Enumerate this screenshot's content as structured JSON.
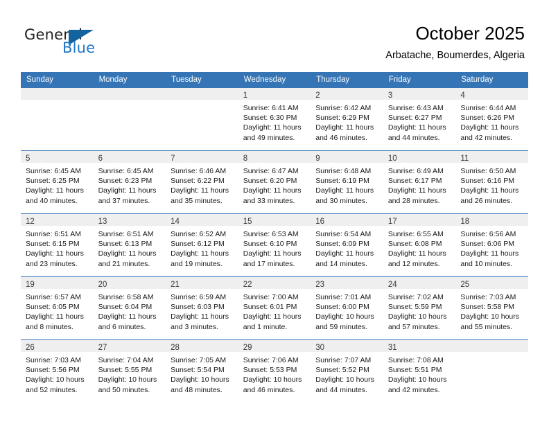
{
  "brand": {
    "name_part1": "General",
    "name_part2": "Blue",
    "triangle_color": "#12639e",
    "blue_color": "#2176c7"
  },
  "header": {
    "title": "October 2025",
    "subtitle": "Arbatache, Boumerdes, Algeria"
  },
  "theme": {
    "header_row_bg": "#3575b5",
    "daynum_band_bg": "#efefef",
    "row_divider": "#3575b5"
  },
  "weekdays": [
    "Sunday",
    "Monday",
    "Tuesday",
    "Wednesday",
    "Thursday",
    "Friday",
    "Saturday"
  ],
  "weeks": [
    [
      {
        "day": "",
        "lines": []
      },
      {
        "day": "",
        "lines": []
      },
      {
        "day": "",
        "lines": []
      },
      {
        "day": "1",
        "lines": [
          "Sunrise: 6:41 AM",
          "Sunset: 6:30 PM",
          "Daylight: 11 hours",
          "and 49 minutes."
        ]
      },
      {
        "day": "2",
        "lines": [
          "Sunrise: 6:42 AM",
          "Sunset: 6:29 PM",
          "Daylight: 11 hours",
          "and 46 minutes."
        ]
      },
      {
        "day": "3",
        "lines": [
          "Sunrise: 6:43 AM",
          "Sunset: 6:27 PM",
          "Daylight: 11 hours",
          "and 44 minutes."
        ]
      },
      {
        "day": "4",
        "lines": [
          "Sunrise: 6:44 AM",
          "Sunset: 6:26 PM",
          "Daylight: 11 hours",
          "and 42 minutes."
        ]
      }
    ],
    [
      {
        "day": "5",
        "lines": [
          "Sunrise: 6:45 AM",
          "Sunset: 6:25 PM",
          "Daylight: 11 hours",
          "and 40 minutes."
        ]
      },
      {
        "day": "6",
        "lines": [
          "Sunrise: 6:45 AM",
          "Sunset: 6:23 PM",
          "Daylight: 11 hours",
          "and 37 minutes."
        ]
      },
      {
        "day": "7",
        "lines": [
          "Sunrise: 6:46 AM",
          "Sunset: 6:22 PM",
          "Daylight: 11 hours",
          "and 35 minutes."
        ]
      },
      {
        "day": "8",
        "lines": [
          "Sunrise: 6:47 AM",
          "Sunset: 6:20 PM",
          "Daylight: 11 hours",
          "and 33 minutes."
        ]
      },
      {
        "day": "9",
        "lines": [
          "Sunrise: 6:48 AM",
          "Sunset: 6:19 PM",
          "Daylight: 11 hours",
          "and 30 minutes."
        ]
      },
      {
        "day": "10",
        "lines": [
          "Sunrise: 6:49 AM",
          "Sunset: 6:17 PM",
          "Daylight: 11 hours",
          "and 28 minutes."
        ]
      },
      {
        "day": "11",
        "lines": [
          "Sunrise: 6:50 AM",
          "Sunset: 6:16 PM",
          "Daylight: 11 hours",
          "and 26 minutes."
        ]
      }
    ],
    [
      {
        "day": "12",
        "lines": [
          "Sunrise: 6:51 AM",
          "Sunset: 6:15 PM",
          "Daylight: 11 hours",
          "and 23 minutes."
        ]
      },
      {
        "day": "13",
        "lines": [
          "Sunrise: 6:51 AM",
          "Sunset: 6:13 PM",
          "Daylight: 11 hours",
          "and 21 minutes."
        ]
      },
      {
        "day": "14",
        "lines": [
          "Sunrise: 6:52 AM",
          "Sunset: 6:12 PM",
          "Daylight: 11 hours",
          "and 19 minutes."
        ]
      },
      {
        "day": "15",
        "lines": [
          "Sunrise: 6:53 AM",
          "Sunset: 6:10 PM",
          "Daylight: 11 hours",
          "and 17 minutes."
        ]
      },
      {
        "day": "16",
        "lines": [
          "Sunrise: 6:54 AM",
          "Sunset: 6:09 PM",
          "Daylight: 11 hours",
          "and 14 minutes."
        ]
      },
      {
        "day": "17",
        "lines": [
          "Sunrise: 6:55 AM",
          "Sunset: 6:08 PM",
          "Daylight: 11 hours",
          "and 12 minutes."
        ]
      },
      {
        "day": "18",
        "lines": [
          "Sunrise: 6:56 AM",
          "Sunset: 6:06 PM",
          "Daylight: 11 hours",
          "and 10 minutes."
        ]
      }
    ],
    [
      {
        "day": "19",
        "lines": [
          "Sunrise: 6:57 AM",
          "Sunset: 6:05 PM",
          "Daylight: 11 hours",
          "and 8 minutes."
        ]
      },
      {
        "day": "20",
        "lines": [
          "Sunrise: 6:58 AM",
          "Sunset: 6:04 PM",
          "Daylight: 11 hours",
          "and 6 minutes."
        ]
      },
      {
        "day": "21",
        "lines": [
          "Sunrise: 6:59 AM",
          "Sunset: 6:03 PM",
          "Daylight: 11 hours",
          "and 3 minutes."
        ]
      },
      {
        "day": "22",
        "lines": [
          "Sunrise: 7:00 AM",
          "Sunset: 6:01 PM",
          "Daylight: 11 hours",
          "and 1 minute."
        ]
      },
      {
        "day": "23",
        "lines": [
          "Sunrise: 7:01 AM",
          "Sunset: 6:00 PM",
          "Daylight: 10 hours",
          "and 59 minutes."
        ]
      },
      {
        "day": "24",
        "lines": [
          "Sunrise: 7:02 AM",
          "Sunset: 5:59 PM",
          "Daylight: 10 hours",
          "and 57 minutes."
        ]
      },
      {
        "day": "25",
        "lines": [
          "Sunrise: 7:03 AM",
          "Sunset: 5:58 PM",
          "Daylight: 10 hours",
          "and 55 minutes."
        ]
      }
    ],
    [
      {
        "day": "26",
        "lines": [
          "Sunrise: 7:03 AM",
          "Sunset: 5:56 PM",
          "Daylight: 10 hours",
          "and 52 minutes."
        ]
      },
      {
        "day": "27",
        "lines": [
          "Sunrise: 7:04 AM",
          "Sunset: 5:55 PM",
          "Daylight: 10 hours",
          "and 50 minutes."
        ]
      },
      {
        "day": "28",
        "lines": [
          "Sunrise: 7:05 AM",
          "Sunset: 5:54 PM",
          "Daylight: 10 hours",
          "and 48 minutes."
        ]
      },
      {
        "day": "29",
        "lines": [
          "Sunrise: 7:06 AM",
          "Sunset: 5:53 PM",
          "Daylight: 10 hours",
          "and 46 minutes."
        ]
      },
      {
        "day": "30",
        "lines": [
          "Sunrise: 7:07 AM",
          "Sunset: 5:52 PM",
          "Daylight: 10 hours",
          "and 44 minutes."
        ]
      },
      {
        "day": "31",
        "lines": [
          "Sunrise: 7:08 AM",
          "Sunset: 5:51 PM",
          "Daylight: 10 hours",
          "and 42 minutes."
        ]
      },
      {
        "day": "",
        "lines": []
      }
    ]
  ]
}
